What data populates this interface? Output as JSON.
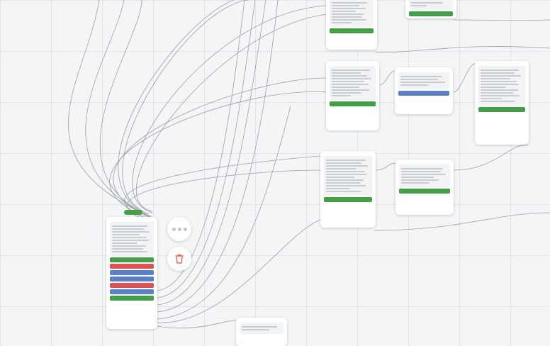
{
  "nodes": {
    "top_center": {
      "button": ""
    },
    "top_right": {
      "title": "",
      "button": ""
    },
    "mid_left": {
      "title": ""
    },
    "mid_center": {
      "title": ""
    },
    "right_tall": {
      "title": ""
    },
    "center": {
      "title": ""
    },
    "center_right": {
      "title": ""
    },
    "start": {
      "title": "",
      "badge": ""
    },
    "bottom": {
      "title": ""
    }
  },
  "fab": {
    "more": "more-icon",
    "delete": "trash-icon"
  },
  "colors": {
    "green": "#43a047",
    "red": "#e05252",
    "blue": "#5c7fc9",
    "delete_accent": "#f06a5a"
  }
}
